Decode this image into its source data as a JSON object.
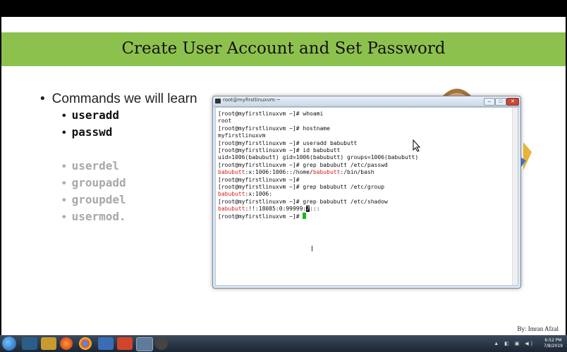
{
  "slide": {
    "title": "Create User Account and Set Password",
    "main_bullet": "Commands we will learn",
    "active_commands": [
      "useradd",
      "passwd"
    ],
    "other_commands": [
      "userdel",
      "groupadd",
      "groupdel",
      "usermod."
    ],
    "author": "By: Imran Afzal"
  },
  "terminal": {
    "window_title": "root@myfirstlinuxvm:~",
    "lines": [
      {
        "parts": [
          {
            "t": "[root@myfirstlinuxvm ~]# whoami"
          }
        ]
      },
      {
        "parts": [
          {
            "t": "root"
          }
        ]
      },
      {
        "parts": [
          {
            "t": "[root@myfirstlinuxvm ~]# hostname"
          }
        ]
      },
      {
        "parts": [
          {
            "t": "myfirstlinuxvm"
          }
        ]
      },
      {
        "parts": [
          {
            "t": "[root@myfirstlinuxvm ~]# useradd babubutt"
          }
        ]
      },
      {
        "parts": [
          {
            "t": "[root@myfirstlinuxvm ~]# id babubutt"
          }
        ]
      },
      {
        "parts": [
          {
            "t": "uid=1006(babubutt) gid=1006(babubutt) groups=1006(babubutt)"
          }
        ]
      },
      {
        "parts": [
          {
            "t": "[root@myfirstlinuxvm ~]# grep babubutt /etc/passwd"
          }
        ]
      },
      {
        "parts": [
          {
            "t": "babubutt",
            "c": "red"
          },
          {
            "t": ":x:1006:1006::/home/"
          },
          {
            "t": "babubutt",
            "c": "red"
          },
          {
            "t": ":/bin/bash"
          }
        ]
      },
      {
        "parts": [
          {
            "t": "[root@myfirstlinuxvm ~]#"
          }
        ]
      },
      {
        "parts": [
          {
            "t": "[root@myfirstlinuxvm ~]# grep babubutt /etc/group"
          }
        ]
      },
      {
        "parts": [
          {
            "t": "babubutt",
            "c": "red"
          },
          {
            "t": ":x:1006:"
          }
        ]
      },
      {
        "parts": [
          {
            "t": "[root@myfirstlinuxvm ~]# grep babubutt /etc/shadow"
          }
        ]
      },
      {
        "parts": [
          {
            "t": "babubutt",
            "c": "red"
          },
          {
            "t": ":!!:18085:0:99999:"
          },
          {
            "t": "7",
            "c": "sel"
          },
          {
            "t": ":::"
          }
        ]
      },
      {
        "parts": [
          {
            "t": "[root@myfirstlinuxvm ~]# "
          }
        ],
        "cursor": true
      }
    ]
  },
  "taskbar": {
    "apps": [
      "windows-explorer-icon",
      "file-manager-icon",
      "firefox-icon",
      "chrome-icon",
      "virtualbox-icon",
      "powerpoint-icon",
      "putty-icon",
      "terminal-icon"
    ],
    "clock_time": "6:52 PM",
    "clock_date": "7/8/2019"
  },
  "colors": {
    "title_bar": "#8dc14d",
    "prompt_highlight": "#d22020",
    "cursor": "#18b818"
  }
}
